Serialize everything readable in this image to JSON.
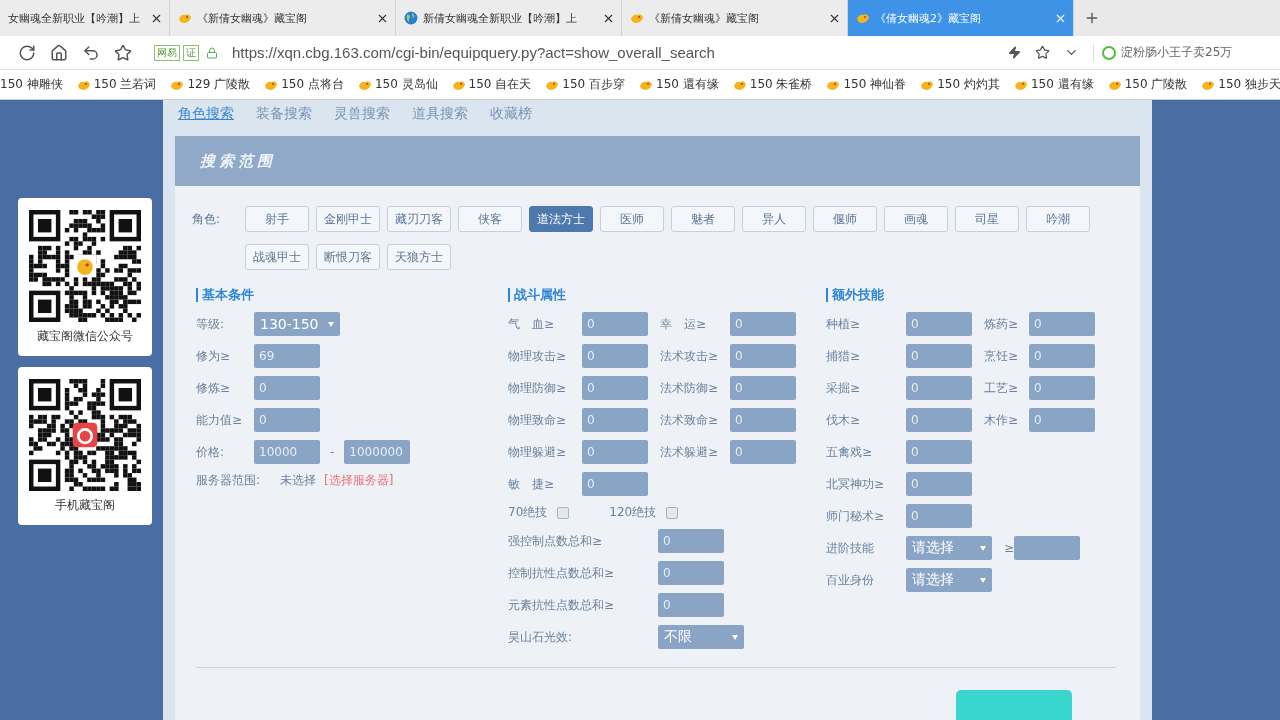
{
  "browser": {
    "tabs": [
      {
        "title": "女幽魂全新职业【吟潮】上",
        "kind": "plain",
        "selected": false
      },
      {
        "title": "《新倩女幽魂》藏宝阁",
        "kind": "cbg",
        "selected": false
      },
      {
        "title": "新倩女幽魂全新职业【吟潮】上",
        "kind": "web",
        "selected": false
      },
      {
        "title": "《新倩女幽魂》藏宝阁",
        "kind": "cbg",
        "selected": false
      },
      {
        "title": "《倩女幽魂2》藏宝阁",
        "kind": "cbg",
        "selected": true
      }
    ],
    "tags": [
      "网易",
      "证"
    ],
    "url": "https://xqn.cbg.163.com/cgi-bin/equipquery.py?act=show_overall_search",
    "search": {
      "placeholder": "淀粉肠小王子卖25万"
    },
    "bookmarks": [
      {
        "label": "150 神雕侠",
        "icon": false
      },
      {
        "label": "150 兰若词",
        "icon": true
      },
      {
        "label": "129 广陵散",
        "icon": true
      },
      {
        "label": "150 点将台",
        "icon": true
      },
      {
        "label": "150 灵岛仙",
        "icon": true
      },
      {
        "label": "150 自在天",
        "icon": true
      },
      {
        "label": "150 百步穿",
        "icon": true
      },
      {
        "label": "150 還有缘",
        "icon": true
      },
      {
        "label": "150 朱雀桥",
        "icon": true
      },
      {
        "label": "150 神仙眷",
        "icon": true
      },
      {
        "label": "150 灼灼其",
        "icon": true
      },
      {
        "label": "150 還有缘",
        "icon": true
      },
      {
        "label": "150 广陵散",
        "icon": true
      },
      {
        "label": "150 独步天",
        "icon": true
      }
    ]
  },
  "qr_cards": [
    {
      "caption": "藏宝阁微信公众号",
      "kind": "wechat"
    },
    {
      "caption": "手机藏宝阁",
      "kind": "app"
    }
  ],
  "nav": [
    {
      "label": "角色搜索",
      "selected": true
    },
    {
      "label": "装备搜索",
      "selected": false
    },
    {
      "label": "灵兽搜索",
      "selected": false
    },
    {
      "label": "道具搜索",
      "selected": false
    },
    {
      "label": "收藏榜",
      "selected": false
    }
  ],
  "panel_title": "搜索范围",
  "roles_label": "角色:",
  "roles": [
    {
      "label": "射手",
      "selected": false
    },
    {
      "label": "金刚甲士",
      "selected": false
    },
    {
      "label": "藏刃刀客",
      "selected": false
    },
    {
      "label": "侠客",
      "selected": false
    },
    {
      "label": "道法方士",
      "selected": true
    },
    {
      "label": "医师",
      "selected": false
    },
    {
      "label": "魅者",
      "selected": false
    },
    {
      "label": "异人",
      "selected": false
    },
    {
      "label": "偃师",
      "selected": false
    },
    {
      "label": "画魂",
      "selected": false
    },
    {
      "label": "司星",
      "selected": false
    },
    {
      "label": "吟潮",
      "selected": false
    },
    {
      "label": "战魂甲士",
      "selected": false
    },
    {
      "label": "断恨刀客",
      "selected": false
    },
    {
      "label": "天狼方士",
      "selected": false
    }
  ],
  "columns": [
    {
      "title": "基本条件",
      "rows": [
        {
          "kind": "fields",
          "fields": [
            {
              "kind": "select",
              "label": "等级:",
              "value": "130-150"
            }
          ]
        },
        {
          "kind": "fields",
          "fields": [
            {
              "kind": "input",
              "label": "修为≥",
              "value": "69"
            }
          ]
        },
        {
          "kind": "fields",
          "fields": [
            {
              "kind": "input",
              "label": "修炼≥",
              "value": "0"
            }
          ]
        },
        {
          "kind": "fields",
          "fields": [
            {
              "kind": "input",
              "label": "能力值≥",
              "value": "0"
            }
          ]
        },
        {
          "kind": "range",
          "label": "价格:",
          "from": "10000",
          "separator": "-",
          "to": "1000000"
        },
        {
          "kind": "text",
          "label": "服务器范围:",
          "value": "未选择",
          "link": "[选择服务器]"
        }
      ]
    },
    {
      "title": "战斗属性",
      "rows": [
        {
          "kind": "fields",
          "fields": [
            {
              "kind": "input",
              "label": "气　血≥",
              "value": "0"
            },
            {
              "kind": "input",
              "label": "幸　运≥",
              "value": "0"
            }
          ]
        },
        {
          "kind": "fields",
          "fields": [
            {
              "kind": "input",
              "label": "物理攻击≥",
              "value": "0"
            },
            {
              "kind": "input",
              "label": "法术攻击≥",
              "value": "0"
            }
          ]
        },
        {
          "kind": "fields",
          "fields": [
            {
              "kind": "input",
              "label": "物理防御≥",
              "value": "0"
            },
            {
              "kind": "input",
              "label": "法术防御≥",
              "value": "0"
            }
          ]
        },
        {
          "kind": "fields",
          "fields": [
            {
              "kind": "input",
              "label": "物理致命≥",
              "value": "0"
            },
            {
              "kind": "input",
              "label": "法术致命≥",
              "value": "0"
            }
          ]
        },
        {
          "kind": "fields",
          "fields": [
            {
              "kind": "input",
              "label": "物理躲避≥",
              "value": "0"
            },
            {
              "kind": "input",
              "label": "法术躲避≥",
              "value": "0"
            }
          ]
        },
        {
          "kind": "fields",
          "fields": [
            {
              "kind": "input",
              "label": "敏　捷≥",
              "value": "0"
            }
          ]
        },
        {
          "kind": "checks",
          "items": [
            {
              "label": "70绝技",
              "checked": false
            },
            {
              "label": "120绝技",
              "checked": false
            }
          ]
        },
        {
          "kind": "wide",
          "fields": [
            {
              "kind": "input",
              "label": "强控制点数总和≥",
              "value": "0"
            }
          ]
        },
        {
          "kind": "wide",
          "fields": [
            {
              "kind": "input",
              "label": "控制抗性点数总和≥",
              "value": "0"
            }
          ]
        },
        {
          "kind": "wide",
          "fields": [
            {
              "kind": "input",
              "label": "元素抗性点数总和≥",
              "value": "0"
            }
          ]
        },
        {
          "kind": "wide",
          "fields": [
            {
              "kind": "select",
              "label": "昊山石光效:",
              "value": "不限"
            }
          ]
        }
      ]
    },
    {
      "title": "额外技能",
      "rows": [
        {
          "kind": "fields",
          "fields": [
            {
              "kind": "input",
              "label": "种植≥",
              "value": "0"
            },
            {
              "kind": "input",
              "label": "炼药≥",
              "value": "0"
            }
          ]
        },
        {
          "kind": "fields",
          "fields": [
            {
              "kind": "input",
              "label": "捕猎≥",
              "value": "0"
            },
            {
              "kind": "input",
              "label": "烹饪≥",
              "value": "0"
            }
          ]
        },
        {
          "kind": "fields",
          "fields": [
            {
              "kind": "input",
              "label": "采掘≥",
              "value": "0"
            },
            {
              "kind": "input",
              "label": "工艺≥",
              "value": "0"
            }
          ]
        },
        {
          "kind": "fields",
          "fields": [
            {
              "kind": "input",
              "label": "伐木≥",
              "value": "0"
            },
            {
              "kind": "input",
              "label": "木作≥",
              "value": "0"
            }
          ]
        },
        {
          "kind": "fields",
          "fields": [
            {
              "kind": "input",
              "label": "五禽戏≥",
              "value": "0"
            }
          ]
        },
        {
          "kind": "fields",
          "fields": [
            {
              "kind": "input",
              "label": "北冥神功≥",
              "value": "0"
            }
          ]
        },
        {
          "kind": "fields",
          "fields": [
            {
              "kind": "input",
              "label": "师门秘术≥",
              "value": "0"
            }
          ]
        },
        {
          "kind": "fields",
          "fields": [
            {
              "kind": "select",
              "label": "进阶技能",
              "value": "请选择"
            },
            {
              "kind": "input",
              "label": "≥"
            }
          ]
        },
        {
          "kind": "fields",
          "fields": [
            {
              "kind": "select",
              "label": "百业身份",
              "value": "请选择"
            }
          ]
        }
      ]
    }
  ]
}
